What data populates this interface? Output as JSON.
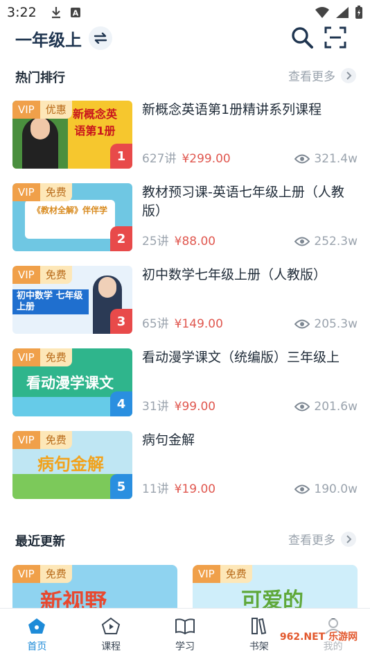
{
  "status_bar": {
    "time": "3:22"
  },
  "header": {
    "grade": "一年级上"
  },
  "hot": {
    "title": "热门排行",
    "more": "查看更多",
    "courses": [
      {
        "tag_vip": "VIP",
        "tag": "优惠",
        "rank": "1",
        "title": "新概念英语第1册精讲系列课程",
        "lessons": "627讲",
        "price": "¥299.00",
        "views": "321.4w",
        "thumb_text": "新概念英语第1册"
      },
      {
        "tag_vip": "VIP",
        "tag": "免费",
        "rank": "2",
        "title": "教材预习课-英语七年级上册（人教版）",
        "lessons": "25讲",
        "price": "¥88.00",
        "views": "252.3w",
        "thumb_text": "《教材全解》伴伴学"
      },
      {
        "tag_vip": "VIP",
        "tag": "免费",
        "rank": "3",
        "title": "初中数学七年级上册（人教版）",
        "lessons": "65讲",
        "price": "¥149.00",
        "views": "205.3w",
        "thumb_text": "初中数学 七年级上册"
      },
      {
        "tag_vip": "VIP",
        "tag": "免费",
        "rank": "4",
        "title": "看动漫学课文（统编版）三年级上",
        "lessons": "31讲",
        "price": "¥99.00",
        "views": "201.6w",
        "thumb_text": "看动漫学课文"
      },
      {
        "tag_vip": "VIP",
        "tag": "免费",
        "rank": "5",
        "title": "病句金解",
        "lessons": "11讲",
        "price": "¥19.00",
        "views": "190.0w",
        "thumb_text": "病句金解"
      }
    ]
  },
  "recent": {
    "title": "最近更新",
    "more": "查看更多",
    "cards": [
      {
        "tag_vip": "VIP",
        "tag": "免费",
        "thumb_text": "新视野"
      },
      {
        "tag_vip": "VIP",
        "tag": "免费",
        "thumb_text": "可爱的"
      }
    ]
  },
  "nav": {
    "items": [
      {
        "label": "首页",
        "icon": "home-icon"
      },
      {
        "label": "课程",
        "icon": "play-icon"
      },
      {
        "label": "学习",
        "icon": "book-icon"
      },
      {
        "label": "书架",
        "icon": "bookshelf-icon"
      },
      {
        "label": "我的",
        "icon": "user-icon"
      }
    ]
  },
  "watermark": "962.NET 乐游网",
  "colors": {
    "accent": "#1e8bd8",
    "price": "#e0574f",
    "vip": "#f0a04a",
    "rank": "#e84a4a"
  }
}
